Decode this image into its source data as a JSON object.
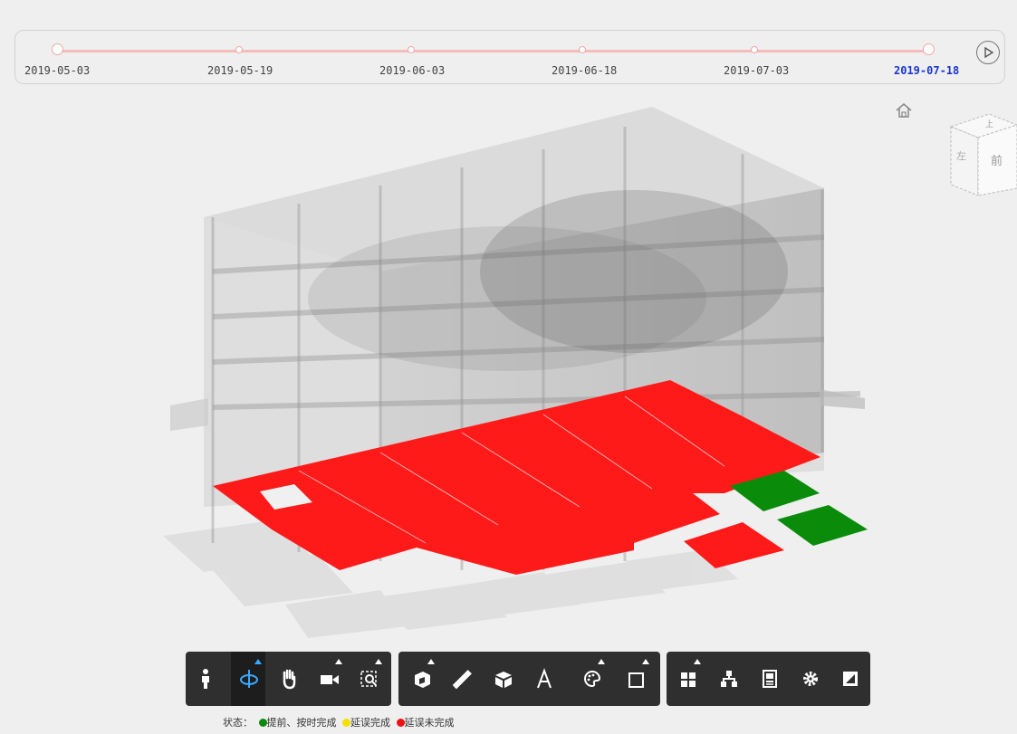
{
  "timeline": {
    "dates": [
      "2019-05-03",
      "2019-05-19",
      "2019-06-03",
      "2019-06-18",
      "2019-07-03",
      "2019-07-18"
    ],
    "active_index": 5
  },
  "view_cube": {
    "top": "上",
    "left": "左",
    "front": "前"
  },
  "legend": {
    "label": "状态：",
    "items": [
      {
        "text": "提前、按时完成",
        "color": "#0a8a0a"
      },
      {
        "text": "延误完成",
        "color": "#f5e000"
      },
      {
        "text": "延误未完成",
        "color": "#ee1111"
      }
    ]
  },
  "toolbar": {
    "groups": [
      [
        "person-icon",
        "orbit-icon",
        "pan-hand-icon",
        "camera-icon",
        "zoom-window-icon"
      ],
      [
        "section-box-icon",
        "measure-ruler-icon",
        "cube-icon",
        "annotate-icon",
        "paint-palette-icon",
        "fullscreen-box-icon"
      ],
      [
        "model-tree-icon",
        "hierarchy-icon",
        "properties-icon",
        "settings-gear-icon",
        "expand-icon"
      ]
    ]
  },
  "colors": {
    "delayed_unfinished": "#ff1a1a",
    "ontime": "#0a8c0a",
    "toolbar_bg": "#2f2f2f",
    "active_date": "#1a35d2"
  }
}
